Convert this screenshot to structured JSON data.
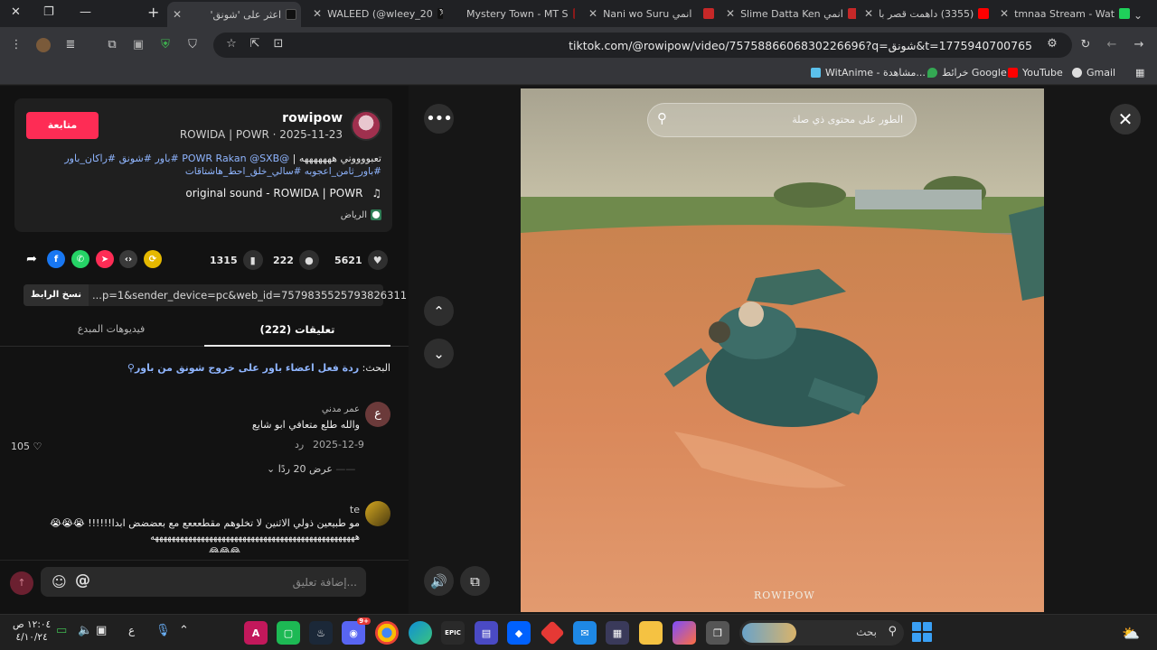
{
  "browser": {
    "tabs": [
      {
        "title": "اعثر على 'شونق'"
      },
      {
        "title": "WALEED (@wleey_20"
      },
      {
        "title": "Mystery Town - MT S"
      },
      {
        "title": "Nani wo Suru انمي"
      },
      {
        "title": "Slime Datta Ken انمي"
      },
      {
        "title": "(3355) داهمت قصر با"
      },
      {
        "title": "tmnaa Stream - Wat"
      }
    ],
    "url": "tiktok.com/@rowipow/video/7575886606830226696?q=شونق&t=1775940700765",
    "bookmarks": [
      {
        "label": "Gmail"
      },
      {
        "label": "YouTube"
      },
      {
        "label": "خرائط Google"
      },
      {
        "label": "WitAnime - مشاهدة..."
      }
    ]
  },
  "creator": {
    "username": "rowipow",
    "subinfo": "ROWIDA | POWR · 2025-11-23",
    "follow_label": "متابعة",
    "caption_text": "تعبووووني هههههههه | ",
    "caption_mention": "@POWR Rakan @SXB",
    "caption_tags_1": "#باور #شونق #راكان_باور",
    "caption_tags_2": "#باور_ثامن_اعجوبه #سالي_خلق_احط_هاشتاقات",
    "sound": "original sound - ROWIDA | POWR",
    "location": "الرياض"
  },
  "actions": {
    "likes": "5621",
    "comments": "222",
    "saves": "1315"
  },
  "link": {
    "text": "...p=1&sender_device=pc&web_id=7579835525793826311",
    "copy_label": "نسخ الرابط"
  },
  "tabs": {
    "comments": "تعليقات (222)",
    "creator_videos": "فيديوهات المبدع"
  },
  "search_suggestion": {
    "prefix": "البحث: ",
    "query": "ردة فعل اعضاء باور على خروج شونق من باور"
  },
  "comments": [
    {
      "avatar_letter": "ع",
      "name": "عمر مدني",
      "text": "والله طلع متعافي ابو شايع",
      "date": "2025-12-9",
      "reply_label": "رد",
      "likes": "105",
      "replies_label": "عرض 20 ردًا"
    },
    {
      "name": "te",
      "text": "مو طبيعين ذولي الاثنين لا تخلوهم مقطعععع مع بعضضض ابدا!!!!!!",
      "text2": "هههههههههههههههههههههههههههههههههههههههههههههههههه"
    }
  ],
  "comment_input": {
    "placeholder": "إضافة تعليق..."
  },
  "video": {
    "search_placeholder": "الطور على محتوى ذي صلة",
    "watermark": "ROWIPOW"
  },
  "taskbar": {
    "time": "١٢:٠٤ ص",
    "date": "٤/١٠/٢٤",
    "search_label": "بحث",
    "lang": "ع",
    "discord_badge": "9+"
  },
  "colors": {
    "accent": "#fe2c55",
    "link": "#8fb5ff"
  }
}
